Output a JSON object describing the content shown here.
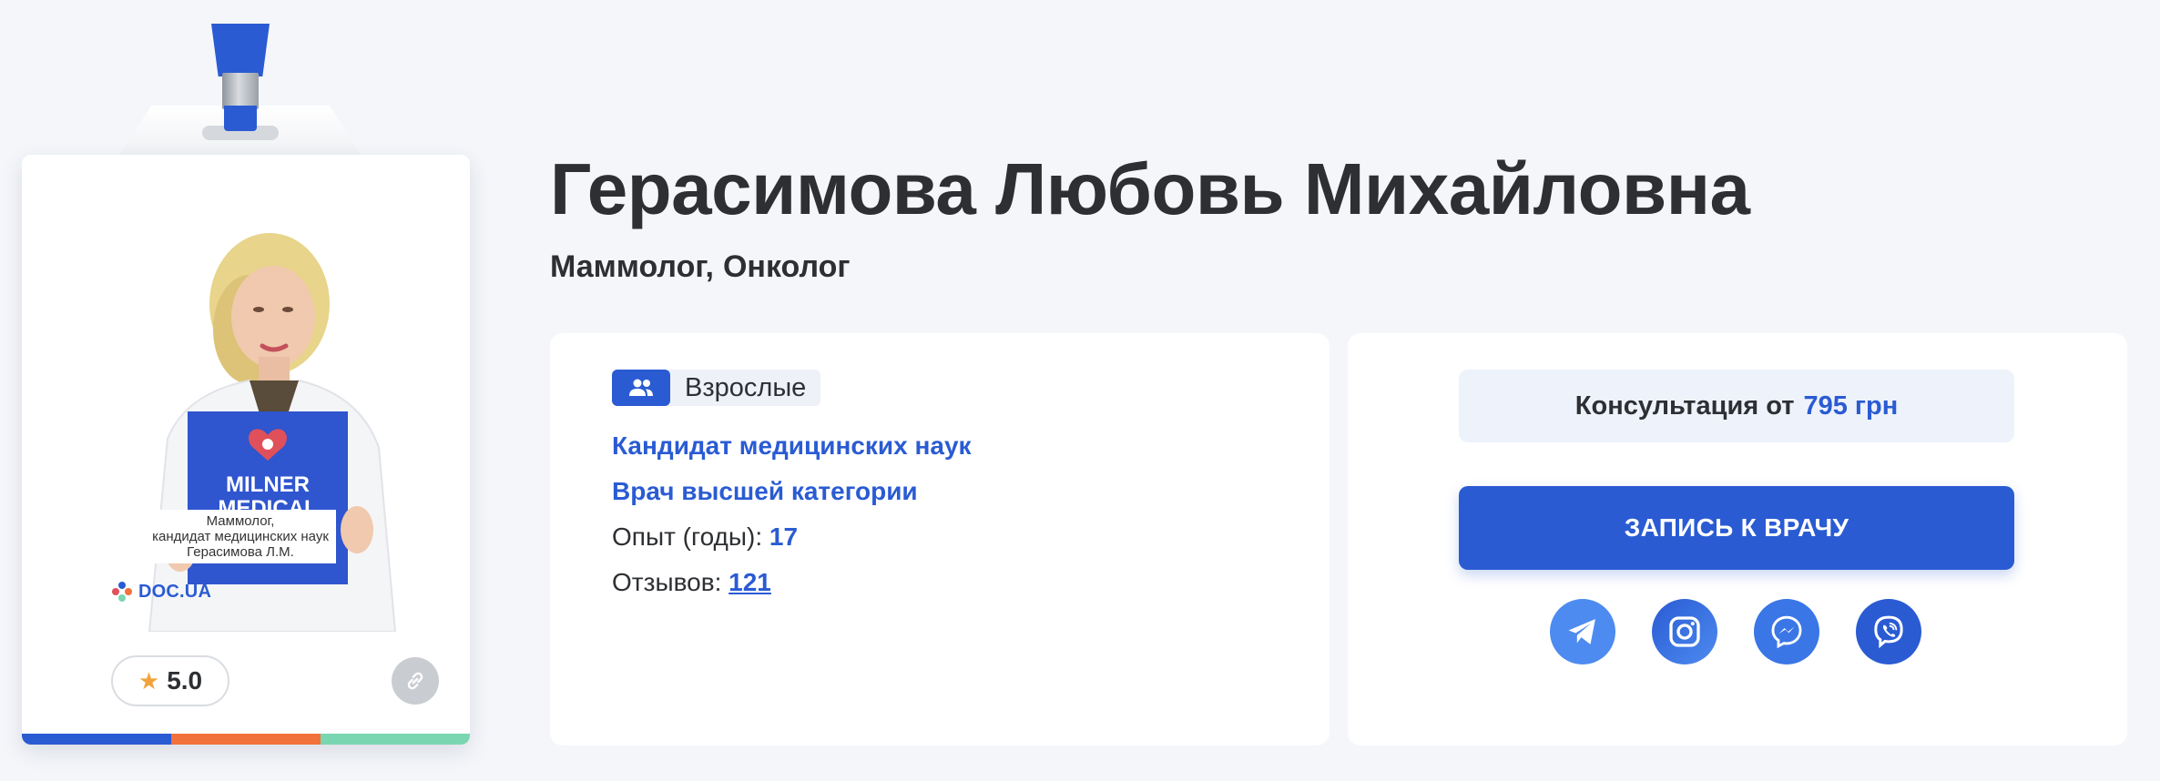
{
  "badge": {
    "photo_caption_line1": "Маммолог,",
    "photo_caption_line2": "кандидат медицинских наук",
    "photo_caption_line3": "Герасимова Л.М.",
    "photo_sign_line1": "MILNER",
    "photo_sign_line2": "MEDICAL",
    "brand": "DOC.UA",
    "rating": "5.0",
    "stripe_colors": [
      "#2a5bd3",
      "#f2713a",
      "#7ad6b0"
    ]
  },
  "doctor": {
    "name": "Герасимова Любовь Михайловна",
    "specialties": [
      "Маммолог,",
      "Онколог"
    ]
  },
  "info": {
    "age_group": "Взрослые",
    "degree": "Кандидат медицинских наук",
    "category": "Врач высшей категории",
    "experience_label": "Опыт (годы):",
    "experience_value": "17",
    "reviews_label": "Отзывов:",
    "reviews_value": "121"
  },
  "booking": {
    "price_label": "Консультация от",
    "price_value": "795 грн",
    "button_label": "ЗАПИСЬ К ВРАЧУ",
    "socials": [
      "telegram-icon",
      "instagram-icon",
      "messenger-icon",
      "viber-icon"
    ]
  },
  "colors": {
    "accent": "#2a5bd3",
    "background": "#f4f6fa",
    "text": "#2d2f33"
  }
}
